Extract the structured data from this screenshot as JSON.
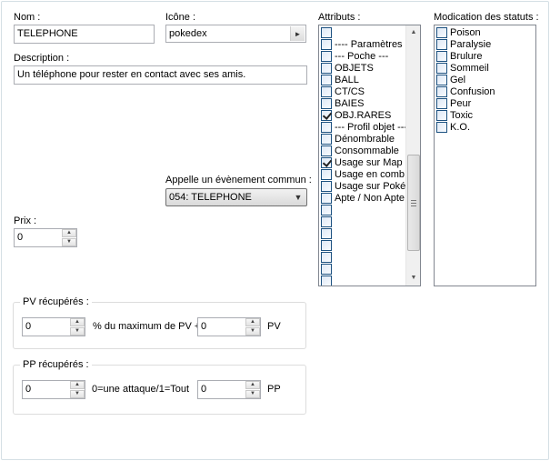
{
  "name_field": {
    "label": "Nom :",
    "value": "TELEPHONE"
  },
  "icon_field": {
    "label": "Icône :",
    "value": "pokedex"
  },
  "description_field": {
    "label": "Description :",
    "value": "Un téléphone pour rester en contact avec ses amis."
  },
  "common_event": {
    "label": "Appelle un évènement commun :",
    "value": "054: TELEPHONE"
  },
  "price": {
    "label": "Prix :",
    "value": "0"
  },
  "attributes": {
    "label": "Attributs :",
    "items": [
      {
        "text": "",
        "checked": false
      },
      {
        "text": "---- Paramètres G",
        "checked": false
      },
      {
        "text": "--- Poche ---",
        "checked": false
      },
      {
        "text": "OBJETS",
        "checked": false
      },
      {
        "text": "BALL",
        "checked": false
      },
      {
        "text": "CT/CS",
        "checked": false
      },
      {
        "text": "BAIES",
        "checked": false
      },
      {
        "text": "OBJ.RARES",
        "checked": true
      },
      {
        "text": "--- Profil objet ---",
        "checked": false
      },
      {
        "text": "Dénombrable",
        "checked": false
      },
      {
        "text": "Consommable",
        "checked": false
      },
      {
        "text": "Usage sur Map",
        "checked": true
      },
      {
        "text": "Usage en comb",
        "checked": false
      },
      {
        "text": "Usage sur Poké",
        "checked": false
      },
      {
        "text": "Apte / Non Apte",
        "checked": false
      },
      {
        "text": "",
        "checked": false
      },
      {
        "text": "",
        "checked": false
      },
      {
        "text": "",
        "checked": false
      },
      {
        "text": "",
        "checked": false
      },
      {
        "text": "",
        "checked": false
      },
      {
        "text": "",
        "checked": false
      },
      {
        "text": "",
        "checked": false
      }
    ]
  },
  "status_changes": {
    "label": "Modication des statuts :",
    "items": [
      {
        "text": "Poison",
        "checked": false
      },
      {
        "text": "Paralysie",
        "checked": false
      },
      {
        "text": "Brulure",
        "checked": false
      },
      {
        "text": "Sommeil",
        "checked": false
      },
      {
        "text": "Gel",
        "checked": false
      },
      {
        "text": "Confusion",
        "checked": false
      },
      {
        "text": "Peur",
        "checked": false
      },
      {
        "text": "Toxic",
        "checked": false
      },
      {
        "text": "K.O.",
        "checked": false
      }
    ]
  },
  "pv_group": {
    "title": "PV récupérés :",
    "percent_value": "0",
    "percent_text": "% du maximum de PV +",
    "flat_value": "0",
    "unit": "PV"
  },
  "pp_group": {
    "title": "PP récupérés :",
    "mode_value": "0",
    "mode_text": "0=une attaque/1=Tout",
    "amount_value": "0",
    "unit": "PP"
  },
  "icons": {
    "combo_arrow": "chevron-right-icon",
    "dropdown_arrow": "triangle-down-icon",
    "spin_up": "spin-up-icon",
    "spin_down": "spin-down-icon"
  }
}
